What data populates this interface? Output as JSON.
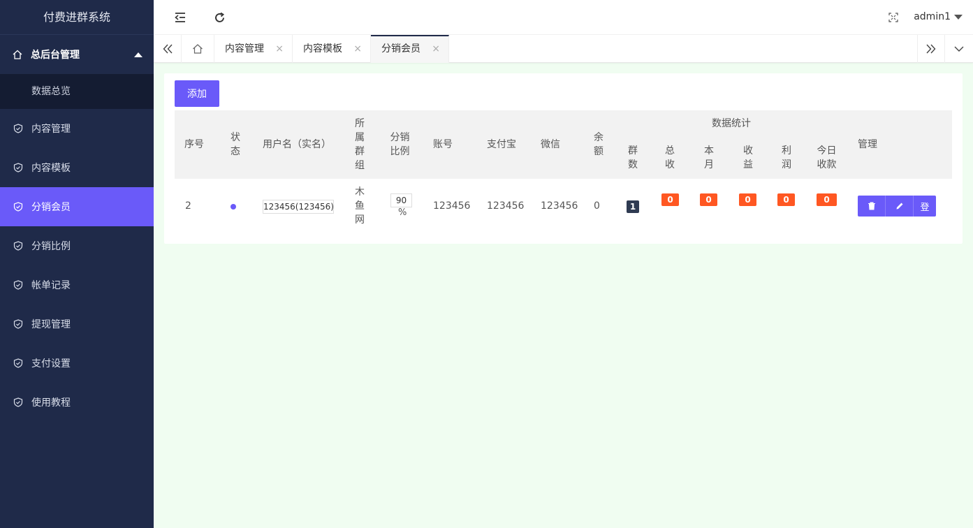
{
  "app": {
    "title": "付费进群系统"
  },
  "sidebar": {
    "top": {
      "label": "总后台管理"
    },
    "sub": {
      "label": "数据总览"
    },
    "items": [
      {
        "label": "内容管理"
      },
      {
        "label": "内容模板"
      },
      {
        "label": "分销会员",
        "active": true
      },
      {
        "label": "分销比例"
      },
      {
        "label": "帐单记录"
      },
      {
        "label": "提现管理"
      },
      {
        "label": "支付设置"
      },
      {
        "label": "使用教程"
      }
    ]
  },
  "header": {
    "user": "admin1"
  },
  "tabs": [
    {
      "label": "内容管理"
    },
    {
      "label": "内容模板"
    },
    {
      "label": "分销会员",
      "active": true
    }
  ],
  "main": {
    "add_label": "添加",
    "table": {
      "headers": {
        "index": "序号",
        "status": "状态",
        "username": "用户名（实名）",
        "group": "所属群组",
        "ratio": "分销比例",
        "account": "账号",
        "alipay": "支付宝",
        "wechat": "微信",
        "balance": "余额",
        "stats": "数据统计",
        "groups": "群数",
        "total": "总收",
        "month": "本月",
        "earnings": "收益",
        "profit": "利润",
        "today": "今日收款",
        "manage": "管理"
      },
      "rows": [
        {
          "index": "2",
          "username": "123456(123456)",
          "group": "木鱼网",
          "ratio": "90",
          "ratio_unit": "%",
          "account": "123456",
          "alipay": "123456",
          "wechat": "123456",
          "balance": "0",
          "groups": "1",
          "total": "0",
          "month": "0",
          "earnings": "0",
          "profit": "0",
          "today": "0",
          "login_label": "登"
        }
      ]
    }
  },
  "colors": {
    "accent": "#6a5af9",
    "sidebar": "#1f2a49",
    "badge_orange": "#ff5722",
    "badge_dark": "#2f3b52"
  }
}
